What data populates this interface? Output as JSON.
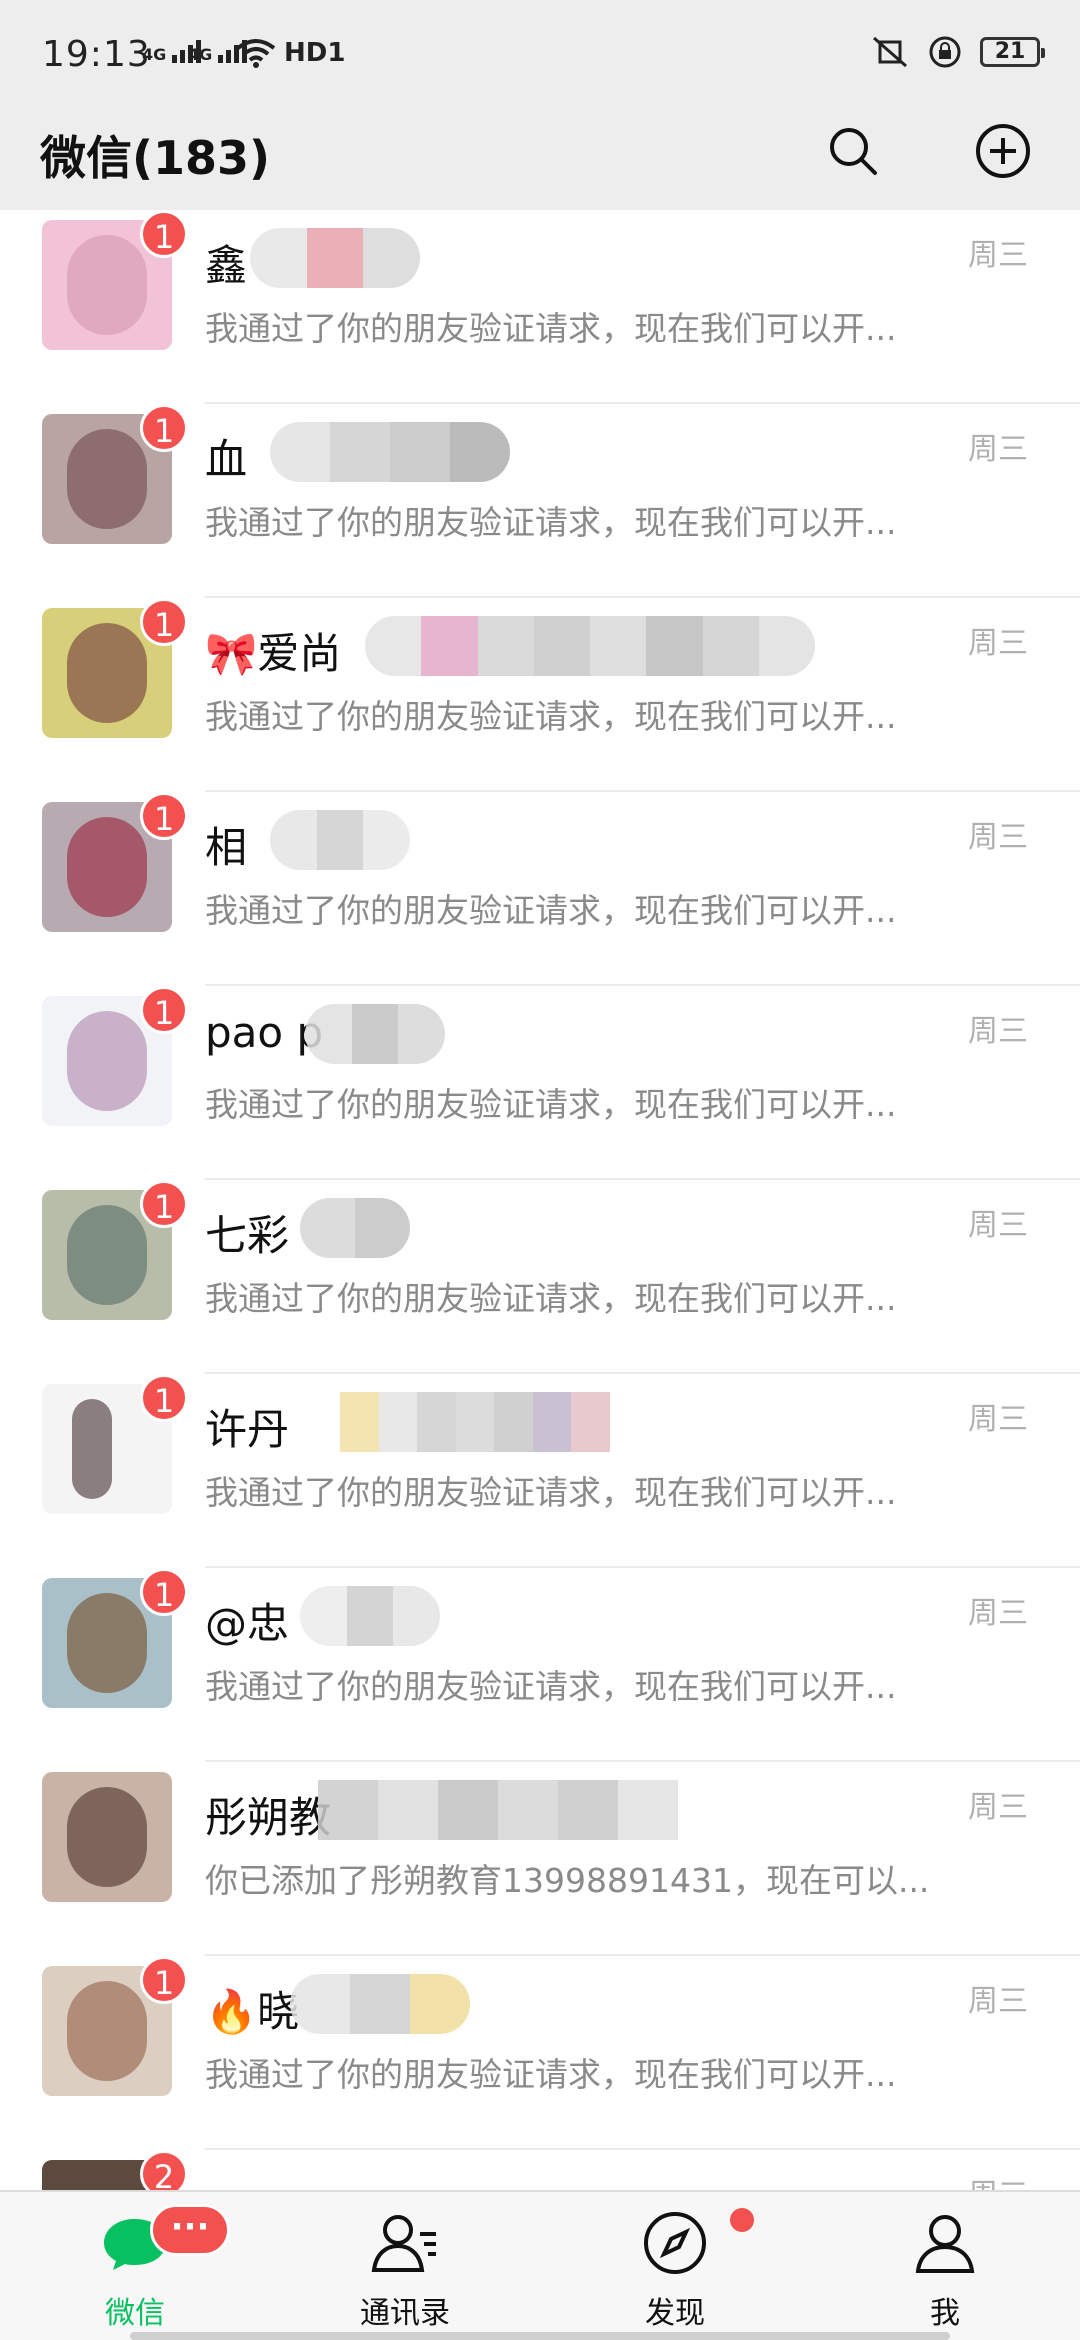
{
  "status_bar": {
    "time": "19:13",
    "net_1": "4G",
    "net_2": "4G",
    "hd": "HD1",
    "battery": "21"
  },
  "header": {
    "title": "微信(183)",
    "search_icon": "search-icon",
    "add_icon": "plus-circle-icon"
  },
  "chats": [
    {
      "name": "鑫",
      "preview": "我通过了你的朋友验证请求，现在我们可以开...",
      "time": "周三",
      "unread": "1",
      "avatar_color": "#e8a9c4"
    },
    {
      "name": "血",
      "preview": "我通过了你的朋友验证请求，现在我们可以开...",
      "time": "周三",
      "unread": "1",
      "avatar_color": "#9e7b78"
    },
    {
      "name": "🎀爱尚",
      "preview": "我通过了你的朋友验证请求，现在我们可以开...",
      "time": "周三",
      "unread": "1",
      "avatar_color": "#c9a36e"
    },
    {
      "name": "相",
      "preview": "我通过了你的朋友验证请求，现在我们可以开...",
      "time": "周三",
      "unread": "1",
      "avatar_color": "#a8a0a6"
    },
    {
      "name": "pao p",
      "preview": "我通过了你的朋友验证请求，现在我们可以开...",
      "time": "周三",
      "unread": "1",
      "avatar_color": "#c8d6e4"
    },
    {
      "name": "七彩",
      "preview": "我通过了你的朋友验证请求，现在我们可以开...",
      "time": "周三",
      "unread": "1",
      "avatar_color": "#a9b8a2"
    },
    {
      "name": "许丹",
      "preview": "我通过了你的朋友验证请求，现在我们可以开...",
      "time": "周三",
      "unread": "1",
      "avatar_color": "#e4e4e4"
    },
    {
      "name": "@忠",
      "preview": "我通过了你的朋友验证请求，现在我们可以开...",
      "time": "周三",
      "unread": "1",
      "avatar_color": "#8ea7b0"
    },
    {
      "name": "彤朔教",
      "preview": "你已添加了彤朔教育13998891431，现在可以...",
      "time": "周三",
      "unread": "",
      "avatar_color": "#9a7c70"
    },
    {
      "name": "🔥晓",
      "preview": "我通过了你的朋友验证请求，现在我们可以开...",
      "time": "周三",
      "unread": "1",
      "avatar_color": "#b99a86"
    },
    {
      "name": "",
      "preview": "",
      "time": "周三",
      "unread": "2",
      "avatar_color": "#5c4a3e"
    }
  ],
  "tabbar": {
    "tabs": [
      {
        "label": "微信",
        "badge": "···"
      },
      {
        "label": "通讯录"
      },
      {
        "label": "发现"
      },
      {
        "label": "我"
      }
    ]
  },
  "colors": {
    "accent": "#07c160",
    "badge": "#f25150",
    "header_bg": "#ededed"
  }
}
